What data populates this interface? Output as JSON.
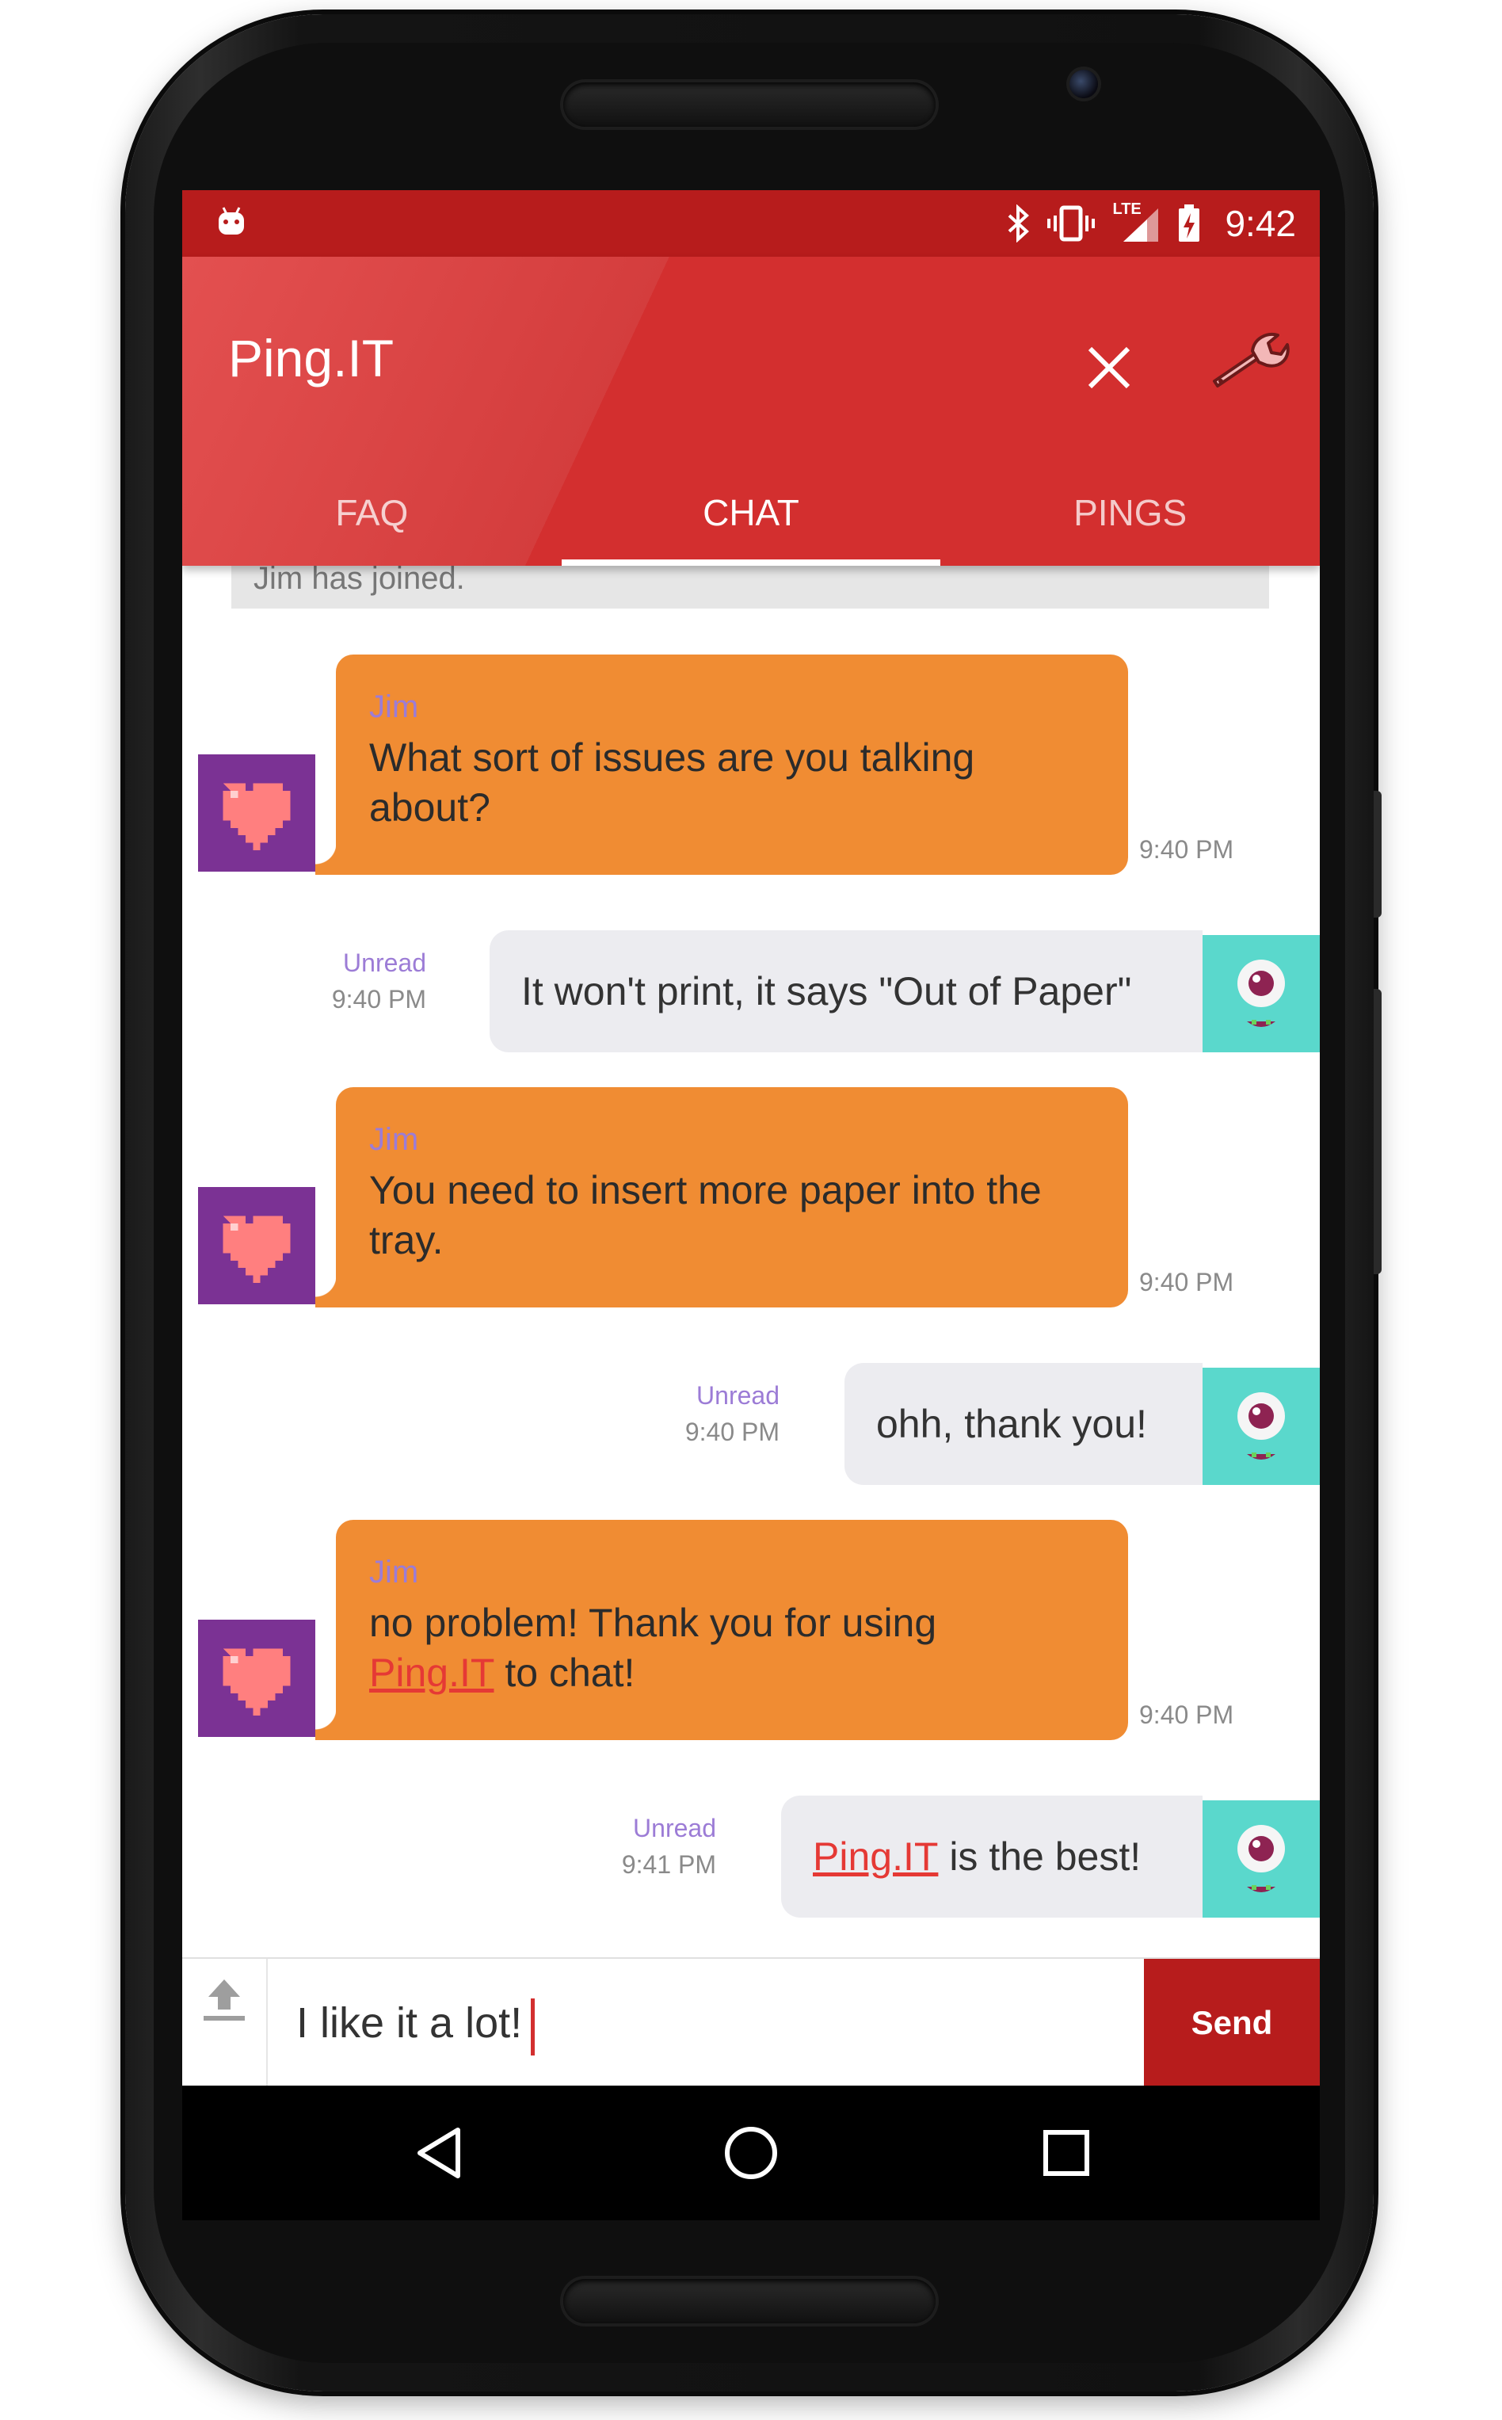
{
  "status_bar": {
    "time": "9:42",
    "network_label": "LTE",
    "icons": [
      "android-icon",
      "bluetooth-icon",
      "vibrate-icon",
      "signal-icon",
      "battery-icon"
    ]
  },
  "app_bar": {
    "title": "Ping.IT",
    "close_icon": "close-icon",
    "settings_icon": "wrench-icon"
  },
  "tabs": [
    {
      "label": "FAQ",
      "active": false
    },
    {
      "label": "CHAT",
      "active": true
    },
    {
      "label": "PINGS",
      "active": false
    }
  ],
  "chat": {
    "system_message": "Jim has joined.",
    "messages": [
      {
        "direction": "in",
        "sender": "Jim",
        "text": "What sort of issues are you talking about?",
        "time": "9:40 PM"
      },
      {
        "direction": "out",
        "text": "It won't print, it says \"Out of Paper\"",
        "status": "Unread",
        "time": "9:40 PM"
      },
      {
        "direction": "in",
        "sender": "Jim",
        "text": "You need to insert more paper into the tray.",
        "time": "9:40 PM"
      },
      {
        "direction": "out",
        "text": "ohh, thank you!",
        "status": "Unread",
        "time": "9:40 PM"
      },
      {
        "direction": "in",
        "sender": "Jim",
        "text_before": "no problem! Thank you for using",
        "link": "Ping.IT",
        "text_after": "to chat!",
        "time": "9:40 PM"
      },
      {
        "direction": "out",
        "link": "Ping.IT",
        "text_after": "is the best!",
        "status": "Unread",
        "time": "9:41 PM"
      }
    ]
  },
  "composer": {
    "upload_icon": "upload-icon",
    "input_value": "I like it a lot!",
    "send_label": "Send"
  },
  "nav_bar": {
    "icons": [
      "back-icon",
      "home-icon",
      "recents-icon"
    ]
  },
  "colors": {
    "status_bar": "#b71c1c",
    "app_bar": "#d32f2f",
    "incoming_bubble": "#f08c33",
    "outgoing_bubble": "#ececf0",
    "sender_name": "#9c7cd6",
    "link": "#e53935",
    "send_button": "#b71c1c",
    "heart_avatar_bg": "#7b3294",
    "monster_avatar_bg": "#5ad8cc"
  }
}
